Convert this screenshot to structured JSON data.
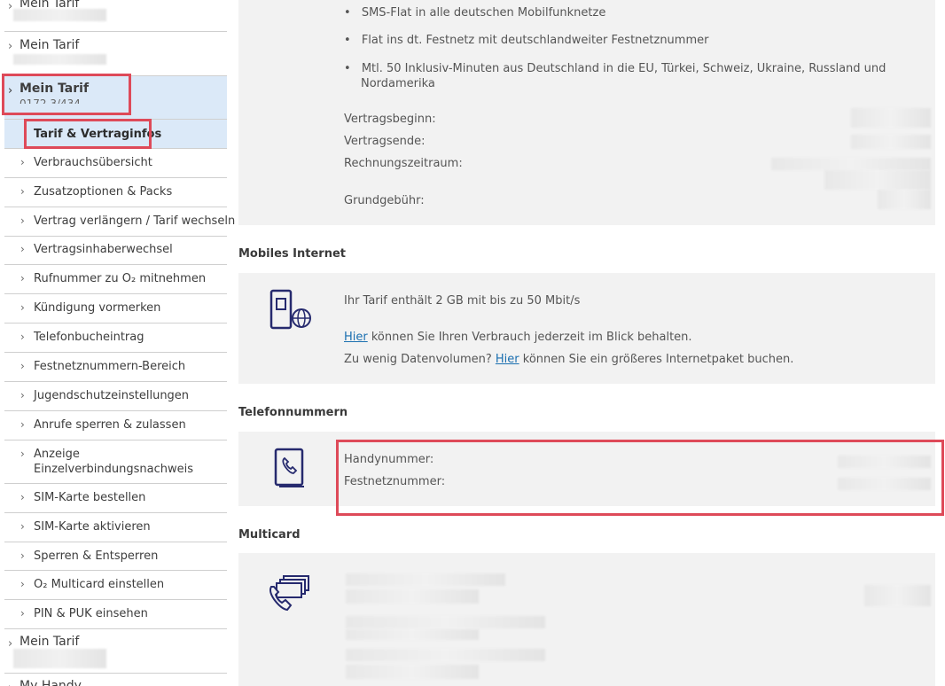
{
  "sidebar": {
    "top_items": [
      {
        "label": "Mein Tarif"
      },
      {
        "label": "Mein Tarif"
      },
      {
        "label": "Mein Tarif",
        "sub_partial": "0172 3/434"
      },
      {
        "label": "Mein Tarif"
      },
      {
        "label": "My Handy"
      }
    ],
    "sub_items": [
      {
        "label": "Tarif & Vertraginfos"
      },
      {
        "label": "Verbrauchsübersicht"
      },
      {
        "label": "Zusatzoptionen & Packs"
      },
      {
        "label": "Vertrag verlängern / Tarif wechseln"
      },
      {
        "label": "Vertragsinhaberwechsel"
      },
      {
        "label": "Rufnummer zu O₂ mitnehmen"
      },
      {
        "label": "Kündigung vormerken"
      },
      {
        "label": "Telefonbucheintrag"
      },
      {
        "label": "Festnetznummern-Bereich"
      },
      {
        "label": "Jugendschutzeinstellungen"
      },
      {
        "label": "Anrufe sperren & zulassen"
      },
      {
        "label": "Anzeige Einzelverbindungsnachweis",
        "line1": "Anzeige",
        "line2": "Einzelverbindungsnachweis"
      },
      {
        "label": "SIM-Karte bestellen"
      },
      {
        "label": "SIM-Karte aktivieren"
      },
      {
        "label": "Sperren & Entsperren"
      },
      {
        "label": "O₂ Multicard einstellen"
      },
      {
        "label": "PIN & PUK einsehen"
      }
    ]
  },
  "tariff": {
    "features": [
      "SMS-Flat in alle deutschen Mobilfunknetze",
      "Flat ins dt. Festnetz mit deutschlandweiter Festnetznummer",
      "Mtl. 50 Inklusiv-Minuten aus Deutschland in die EU, Türkei, Schweiz, Ukraine, Russland und",
      "Nordamerika"
    ],
    "labels": {
      "start": "Vertragsbeginn:",
      "end": "Vertragsende:",
      "billing": "Rechnungszeitraum:",
      "fee": "Grundgebühr:"
    }
  },
  "internet": {
    "title": "Mobiles Internet",
    "plan_text": "Ihr Tarif enthält 2 GB mit bis zu 50 Mbit/s",
    "link1": "Hier",
    "line1_rest": " können Sie Ihren Verbrauch jederzeit im Blick behalten.",
    "line2_prefix": "Zu wenig Datenvolumen? ",
    "link2": "Hier",
    "line2_rest": " können Sie ein größeres Internetpaket buchen."
  },
  "phone_numbers": {
    "title": "Telefonnummern",
    "mobile_label": "Handynummer:",
    "landline_label": "Festnetznummer:"
  },
  "multicard": {
    "title": "Multicard"
  },
  "colors": {
    "highlight": "#de4a59",
    "active_bg": "#dbe9f8",
    "icon": "#262a6e",
    "link": "#1a6fb0"
  }
}
